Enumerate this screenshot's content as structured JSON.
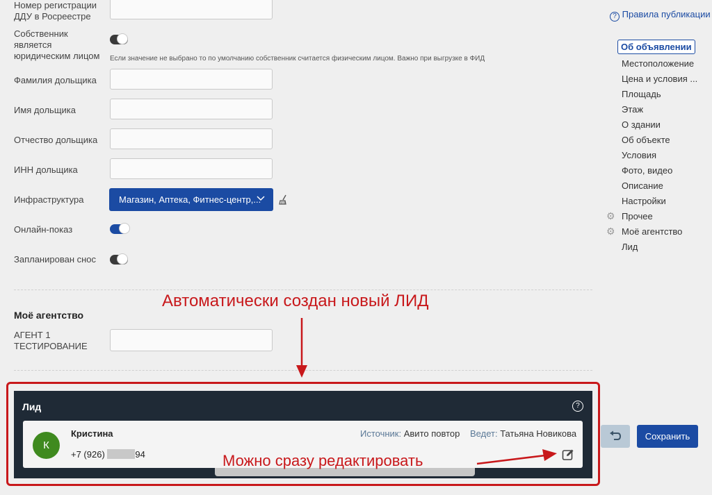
{
  "form": {
    "ddu_label": "Номер регистрации ДДУ в Росреестре",
    "legal_owner_label": "Собственник является юридическим лицом",
    "legal_owner_hint": "Если значение не выбрано то по умолчанию собственник считается физическим лицом. Важно при выгрузке в ФИД",
    "surname_label": "Фамилия дольщика",
    "name_label": "Имя дольщика",
    "patronymic_label": "Отчество дольщика",
    "inn_label": "ИНН дольщика",
    "infra_label": "Инфраструктура",
    "infra_value": "Магазин, Аптека, Фитнес-центр,...",
    "online_label": "Онлайн-показ",
    "demolition_label": "Запланирован снос",
    "agency_title": "Моё агентство",
    "agent_label": "АГЕНТ 1 ТЕСТИРОВАНИЕ"
  },
  "sidebar": {
    "publish_rules": "Правила публикации",
    "items": [
      {
        "label": "Об объявлении",
        "active": true
      },
      {
        "label": "Местоположение"
      },
      {
        "label": "Цена и условия ..."
      },
      {
        "label": "Площадь"
      },
      {
        "label": "Этаж"
      },
      {
        "label": "О здании"
      },
      {
        "label": "Об объекте"
      },
      {
        "label": "Условия"
      },
      {
        "label": "Фото, видео"
      },
      {
        "label": "Описание"
      },
      {
        "label": "Настройки"
      },
      {
        "label": "Прочее",
        "icon": "gear-icon"
      },
      {
        "label": "Моё агентство",
        "icon": "gear-icon"
      },
      {
        "label": "Лид"
      }
    ]
  },
  "lead": {
    "title": "Лид",
    "avatar_letter": "К",
    "name": "Кристина",
    "phone_prefix": "+7 (926)",
    "phone_suffix": "94",
    "source_label": "Источник:",
    "source_value": "Авито повтор",
    "manager_label": "Ведет:",
    "manager_value": "Татьяна Новикова"
  },
  "actions": {
    "save_label": "Сохранить"
  },
  "annotations": {
    "top": "Автоматически создан новый ЛИД",
    "bottom": "Можно сразу редактировать"
  },
  "colors": {
    "primary": "#1b4ba3",
    "dark_panel": "#1f2a36",
    "annotation": "#c8181b",
    "avatar": "#3f8a1f"
  }
}
